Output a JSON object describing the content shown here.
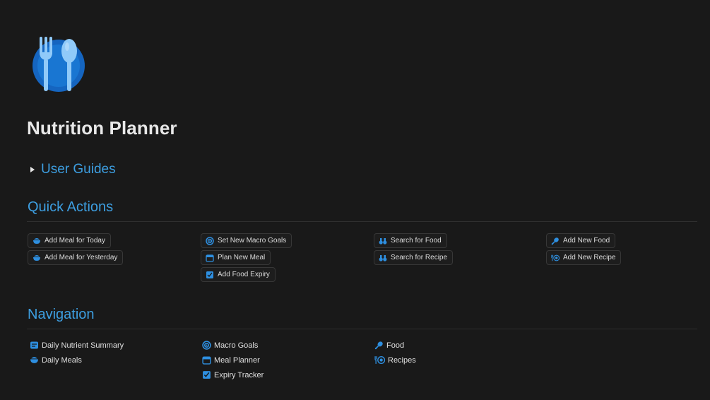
{
  "page": {
    "title": "Nutrition Planner",
    "icon": "fork-spoon-icon",
    "accent": "#3d9ee0",
    "background": "#191919"
  },
  "toggle": {
    "label": "User Guides"
  },
  "quick_actions": {
    "heading": "Quick Actions",
    "buttons": [
      {
        "label": "Add Meal for Today",
        "icon": "bowl-icon"
      },
      {
        "label": "Add Meal for Yesterday",
        "icon": "bowl-icon"
      },
      {
        "label": "Set New Macro Goals",
        "icon": "target-icon"
      },
      {
        "label": "Plan New Meal",
        "icon": "calendar-icon"
      },
      {
        "label": "Add Food Expiry",
        "icon": "expiry-icon"
      },
      {
        "label": "Search for Food",
        "icon": "binoculars-icon"
      },
      {
        "label": "Search for Recipe",
        "icon": "binoculars-icon"
      },
      {
        "label": "Add New Food",
        "icon": "drumstick-icon"
      },
      {
        "label": "Add New Recipe",
        "icon": "plate-cutlery-icon"
      }
    ]
  },
  "navigation": {
    "heading": "Navigation",
    "links": [
      {
        "label": "Daily Nutrient Summary",
        "icon": "summary-icon"
      },
      {
        "label": "Daily Meals",
        "icon": "bowl-icon"
      },
      {
        "label": "Macro Goals",
        "icon": "target-icon"
      },
      {
        "label": "Meal Planner",
        "icon": "calendar-icon"
      },
      {
        "label": "Expiry Tracker",
        "icon": "expiry-icon"
      },
      {
        "label": "Food",
        "icon": "drumstick-icon"
      },
      {
        "label": "Recipes",
        "icon": "plate-cutlery-icon"
      }
    ]
  }
}
